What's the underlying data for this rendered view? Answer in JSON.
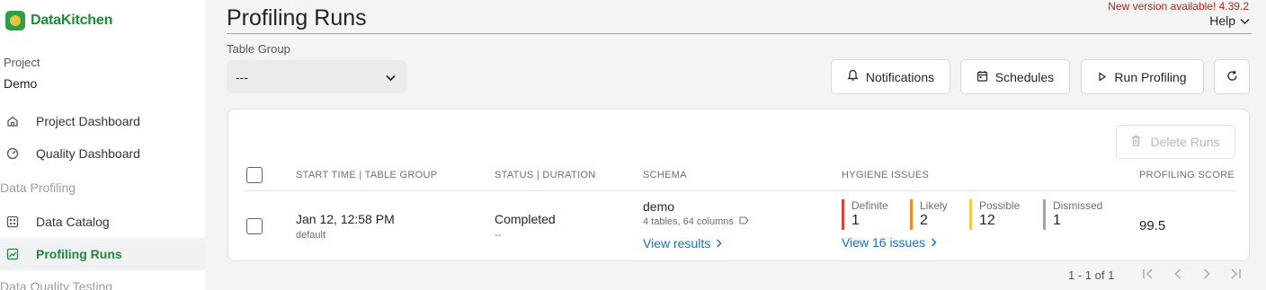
{
  "brand": {
    "name": "DataKitchen",
    "accent": "#1d8a3a"
  },
  "sidebar": {
    "project_label": "Project",
    "project_value": "Demo",
    "items": [
      {
        "label": "Project Dashboard",
        "icon": "home-icon"
      },
      {
        "label": "Quality Dashboard",
        "icon": "gauge-icon"
      },
      {
        "label": "Data Catalog",
        "icon": "grid-icon"
      },
      {
        "label": "Profiling Runs",
        "icon": "chart-icon"
      }
    ],
    "sections": [
      "Data Profiling",
      "Data Quality Testing"
    ]
  },
  "header": {
    "title": "Profiling Runs",
    "new_version": "New version available! 4.39.2",
    "help": "Help"
  },
  "controls": {
    "table_group_label": "Table Group",
    "table_group_value": "---",
    "notifications": "Notifications",
    "schedules": "Schedules",
    "run_profiling": "Run Profiling",
    "delete_runs": "Delete Runs"
  },
  "table": {
    "columns": [
      "START TIME | TABLE GROUP",
      "STATUS | DURATION",
      "SCHEMA",
      "HYGIENE ISSUES",
      "PROFILING SCORE"
    ],
    "rows": [
      {
        "start_time": "Jan 12, 12:58 PM",
        "table_group": "default",
        "status": "Completed",
        "duration": "--",
        "schema": "demo",
        "schema_detail": "4 tables, 64 columns",
        "view_results": "View results",
        "issues": [
          {
            "label": "Definite",
            "value": "1",
            "color": "#d9453a"
          },
          {
            "label": "Likely",
            "value": "2",
            "color": "#ef8b2c"
          },
          {
            "label": "Possible",
            "value": "12",
            "color": "#f2c94c"
          },
          {
            "label": "Dismissed",
            "value": "1",
            "color": "#a0a3a8"
          }
        ],
        "view_issues": "View 16 issues",
        "score": "99.5"
      }
    ]
  },
  "pagination": {
    "text": "1 - 1 of 1"
  }
}
